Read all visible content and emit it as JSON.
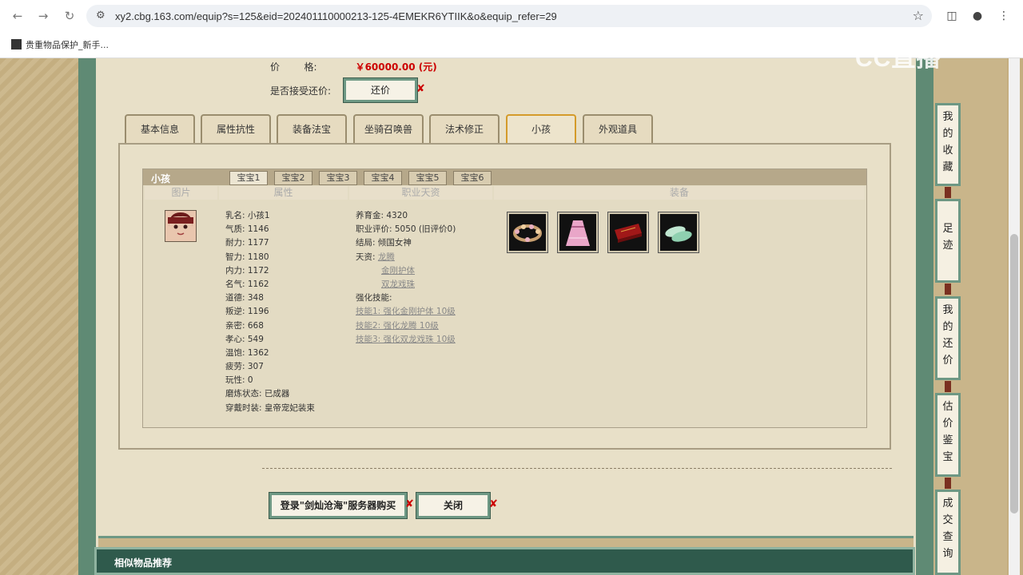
{
  "browser": {
    "url": "xy2.cbg.163.com/equip?s=125&eid=202401110000213-125-4EMEKR6YTIIK&o&equip_refer=29",
    "bookmark": "贵重物品保护_新手..."
  },
  "watermark": "CC直播",
  "price": {
    "label": "价        格:",
    "value": "￥60000.00 (元)"
  },
  "counter_offer": {
    "label": "是否接受还价:",
    "button": "还价"
  },
  "tabs": [
    "基本信息",
    "属性抗性",
    "装备法宝",
    "坐骑召唤兽",
    "法术修正",
    "小孩",
    "外观道具"
  ],
  "active_tab": "小孩",
  "child_panel": {
    "title": "小孩",
    "subtabs": [
      "宝宝1",
      "宝宝2",
      "宝宝3",
      "宝宝4",
      "宝宝5",
      "宝宝6"
    ],
    "columns": [
      "图片",
      "属性",
      "职业天资",
      "装备"
    ],
    "attributes": [
      "乳名: 小孩1",
      "气质: 1146",
      "耐力: 1177",
      "智力: 1180",
      "内力: 1172",
      "名气: 1162",
      "道德: 348",
      "叛逆: 1196",
      "亲密: 668",
      "孝心: 549",
      "温饱: 1362",
      "疲劳: 307",
      "玩性: 0",
      "磨炼状态: 已成器",
      "穿戴时装: 皇帝宠妃装束"
    ],
    "career": {
      "raise_gold": "养育金: 4320",
      "rating": "职业评价: 5050 (旧评价0)",
      "ending": "结局: 倾国女神",
      "talent_label": "天资:",
      "talents": [
        "龙腾",
        "金刚护体",
        "双龙戏珠"
      ],
      "skills_label": "强化技能:",
      "skills": [
        "技能1: 强化金刚护体 10级",
        "技能2: 强化龙腾 10级",
        "技能3: 强化双龙戏珠 10级"
      ]
    },
    "equipment_icons": [
      "flower-wreath-icon",
      "pink-dress-icon",
      "red-box-icon",
      "jade-shoes-icon"
    ]
  },
  "actions": {
    "buy": "登录\"剑灿沧海\"服务器购买",
    "close": "关闭"
  },
  "similar_title": "相似物品推荐",
  "sidebar": [
    "我的收藏",
    "足迹",
    "我的还价",
    "估价鉴宝",
    "成交查询"
  ]
}
